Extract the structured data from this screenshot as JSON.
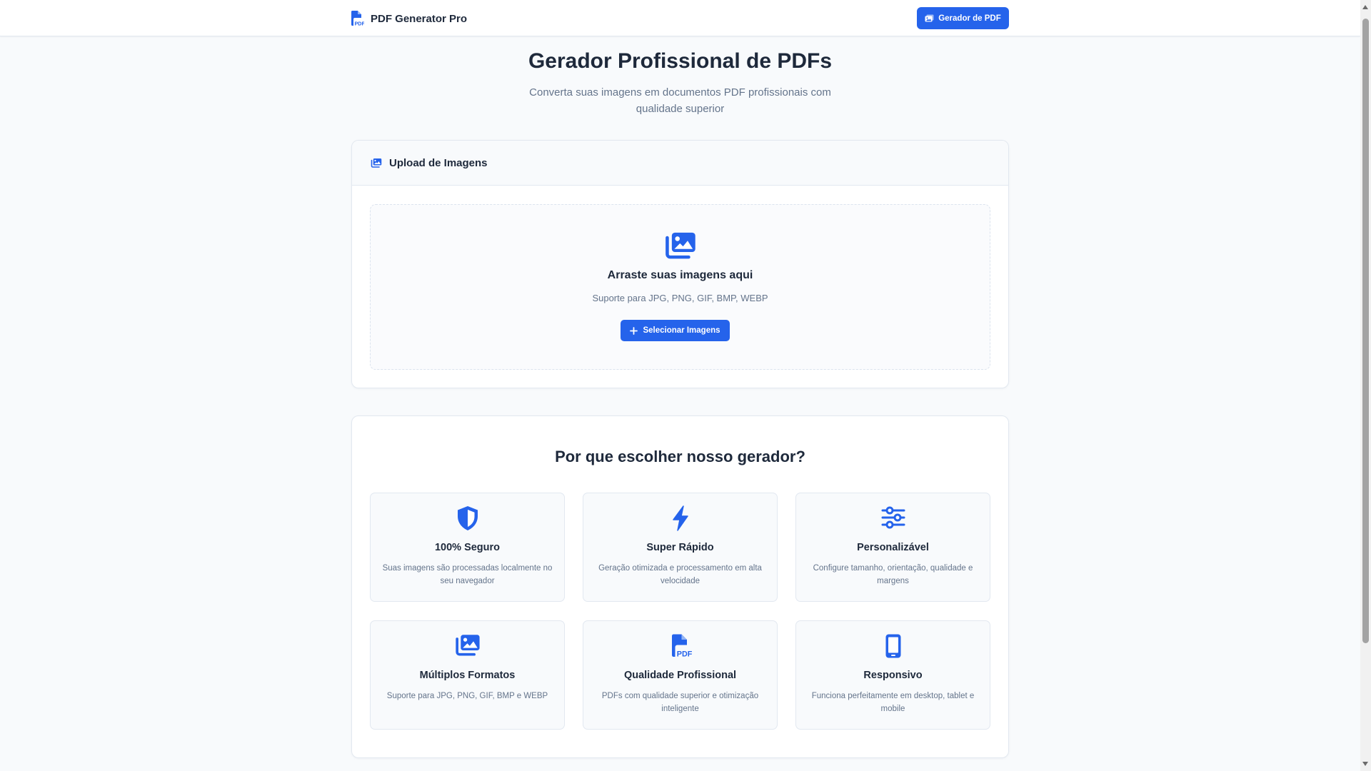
{
  "navbar": {
    "brand": "PDF Generator Pro",
    "brand_icon": "file-pdf-icon",
    "button_label": "Gerador de PDF",
    "button_icon": "pdf-generator-icon"
  },
  "hero": {
    "title": "Gerador Profissional de PDFs",
    "subtitle": "Converta suas imagens em documentos PDF profissionais com qualidade superior"
  },
  "upload": {
    "header_title": "Upload de Imagens",
    "header_icon": "images-icon",
    "dropzone_icon": "images-icon",
    "dropzone_title": "Arraste suas imagens aqui",
    "dropzone_subtitle": "Suporte para JPG, PNG, GIF, BMP, WEBP",
    "button_label": "Selecionar Imagens",
    "button_icon": "plus-icon"
  },
  "features": {
    "title": "Por que escolher nosso gerador?",
    "items": [
      {
        "icon": "shield-icon",
        "title": "100% Seguro",
        "description": "Suas imagens são processadas localmente no seu navegador"
      },
      {
        "icon": "bolt-icon",
        "title": "Super Rápido",
        "description": "Geração otimizada e processamento em alta velocidade"
      },
      {
        "icon": "sliders-icon",
        "title": "Personalizável",
        "description": "Configure tamanho, orientação, qualidade e margens"
      },
      {
        "icon": "images-icon",
        "title": "Múltiplos Formatos",
        "description": "Suporte para JPG, PNG, GIF, BMP e WEBP"
      },
      {
        "icon": "file-pdf-icon",
        "title": "Qualidade Profissional",
        "description": "PDFs com qualidade superior e otimização inteligente"
      },
      {
        "icon": "mobile-icon",
        "title": "Responsivo",
        "description": "Funciona perfeitamente em desktop, tablet e mobile"
      }
    ]
  },
  "colors": {
    "accent": "#2563eb",
    "background": "#f8fafc",
    "text": "#1e293b",
    "muted": "#64748b",
    "border": "#e2e8f0"
  }
}
